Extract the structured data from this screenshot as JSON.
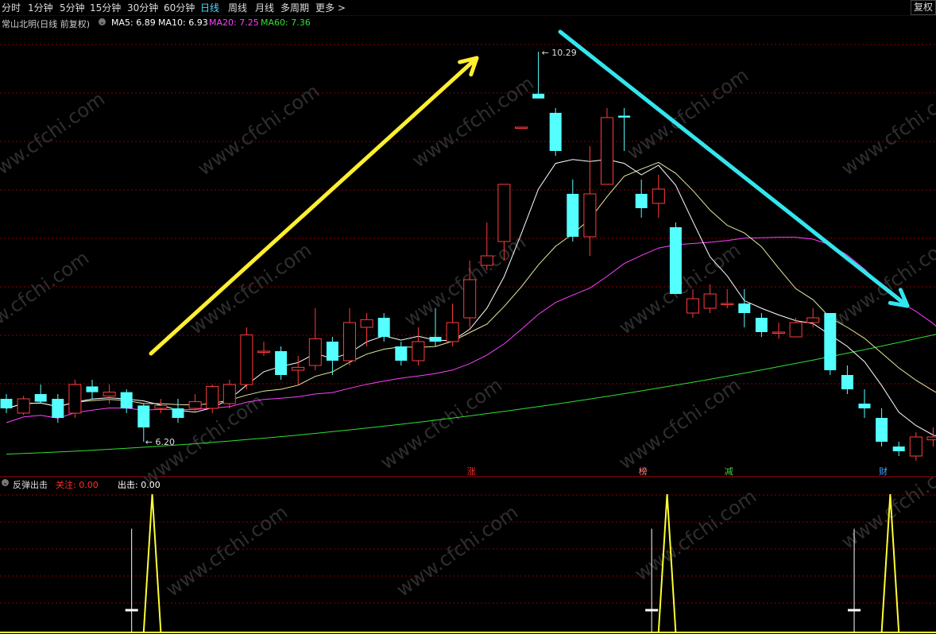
{
  "toolbar": {
    "items": [
      "分时",
      "1分钟",
      "5分钟",
      "15分钟",
      "30分钟",
      "60分钟",
      "日线",
      "周线",
      "月线",
      "多周期",
      "更多 >"
    ],
    "active_index": 6,
    "fq_button": "复权"
  },
  "main_info": {
    "title": "常山北明(日线 前复权)",
    "ma5": "MA5: 6.89",
    "ma10": "MA10: 6.93",
    "ma20": "MA20: 7.25",
    "ma60": "MA60: 7.36"
  },
  "indicator_info": {
    "name": "反弹出击",
    "focus": "关注: 0.00",
    "strike": "出击: 0.00"
  },
  "watermark": "www.cfchi.com",
  "event_markers": [
    {
      "label": "涨",
      "color": "#ff3030",
      "index": 27
    },
    {
      "label": "榜",
      "color": "#ff8080",
      "index": 37
    },
    {
      "label": "减",
      "color": "#40d040",
      "index": 42
    },
    {
      "label": "财",
      "color": "#40a0ff",
      "index": 51
    }
  ],
  "annotations": {
    "high_label": "10.29",
    "low_label": "6.20"
  },
  "colors": {
    "up": "#ff3c3c",
    "down": "#54ffff",
    "ma5": "#ffffff",
    "ma10": "#e8e8a0",
    "ma20": "#ff40ff",
    "ma60": "#30e030",
    "arrow_up": "#ffef30",
    "arrow_down": "#33e5ee",
    "grid": "#8a0000",
    "indicator_line": "#ffff30",
    "indicator_bar": "#ffffff"
  },
  "chart_data": {
    "type": "candlestick",
    "y_range": [
      6.0,
      10.5
    ],
    "candles": [
      [
        6.65,
        6.55,
        6.7,
        6.5
      ],
      [
        6.5,
        6.65,
        6.68,
        6.48
      ],
      [
        6.7,
        6.62,
        6.8,
        6.6
      ],
      [
        6.65,
        6.45,
        6.7,
        6.4
      ],
      [
        6.5,
        6.8,
        6.85,
        6.45
      ],
      [
        6.78,
        6.72,
        6.85,
        6.65
      ],
      [
        6.68,
        6.72,
        6.8,
        6.6
      ],
      [
        6.72,
        6.55,
        6.75,
        6.5
      ],
      [
        6.58,
        6.35,
        6.6,
        6.2
      ],
      [
        6.55,
        6.58,
        6.65,
        6.5
      ],
      [
        6.55,
        6.45,
        6.65,
        6.4
      ],
      [
        6.55,
        6.62,
        6.7,
        6.52
      ],
      [
        6.55,
        6.78,
        6.8,
        6.5
      ],
      [
        6.6,
        6.8,
        6.85,
        6.55
      ],
      [
        6.8,
        7.32,
        7.4,
        6.75
      ],
      [
        7.15,
        7.15,
        7.25,
        7.1
      ],
      [
        7.15,
        6.9,
        7.2,
        6.85
      ],
      [
        6.95,
        6.98,
        7.1,
        6.8
      ],
      [
        7.0,
        7.28,
        7.6,
        6.95
      ],
      [
        7.25,
        7.05,
        7.3,
        6.9
      ],
      [
        7.05,
        7.45,
        7.6,
        7.0
      ],
      [
        7.4,
        7.48,
        7.55,
        7.2
      ],
      [
        7.5,
        7.3,
        7.55,
        7.25
      ],
      [
        7.2,
        7.05,
        7.25,
        7.0
      ],
      [
        7.05,
        7.25,
        7.4,
        7.0
      ],
      [
        7.3,
        7.25,
        7.6,
        7.2
      ],
      [
        7.25,
        7.45,
        7.65,
        7.2
      ],
      [
        7.5,
        7.9,
        8.1,
        7.4
      ],
      [
        8.05,
        8.15,
        8.5,
        8.0
      ],
      [
        8.3,
        8.9,
        8.9,
        8.1
      ],
      [
        9.5,
        9.5,
        9.5,
        9.5
      ],
      [
        9.85,
        9.8,
        10.29,
        9.8
      ],
      [
        9.65,
        9.25,
        9.7,
        9.2
      ],
      [
        8.8,
        8.35,
        8.95,
        8.3
      ],
      [
        8.35,
        8.8,
        9.3,
        8.15
      ],
      [
        8.9,
        9.6,
        9.7,
        8.9
      ],
      [
        9.62,
        9.6,
        9.7,
        9.25
      ],
      [
        8.8,
        8.65,
        8.95,
        8.55
      ],
      [
        8.7,
        8.85,
        9.0,
        8.55
      ],
      [
        8.45,
        7.75,
        8.5,
        7.75
      ],
      [
        7.55,
        7.7,
        7.8,
        7.5
      ],
      [
        7.6,
        7.75,
        7.85,
        7.55
      ],
      [
        7.65,
        7.65,
        7.8,
        7.6
      ],
      [
        7.65,
        7.55,
        7.8,
        7.4
      ],
      [
        7.5,
        7.35,
        7.55,
        7.3
      ],
      [
        7.35,
        7.35,
        7.45,
        7.28
      ],
      [
        7.3,
        7.45,
        7.5,
        7.3
      ],
      [
        7.45,
        7.5,
        7.6,
        7.4
      ],
      [
        7.55,
        6.95,
        7.55,
        6.9
      ],
      [
        6.9,
        6.75,
        7.0,
        6.7
      ],
      [
        6.6,
        6.55,
        6.75,
        6.45
      ],
      [
        6.45,
        6.2,
        6.55,
        6.15
      ],
      [
        6.15,
        6.1,
        6.2,
        6.05
      ],
      [
        6.05,
        6.25,
        6.3,
        6.0
      ],
      [
        6.22,
        6.25,
        6.35,
        6.15
      ],
      [
        6.25,
        6.35,
        6.45,
        6.2
      ]
    ],
    "ma60_endpoints": [
      6.07,
      7.36
    ],
    "indicator": {
      "y_range": [
        0,
        100
      ],
      "spikes": [
        {
          "start": 8,
          "peak": 8.5,
          "end": 9,
          "value": 100
        },
        {
          "start": 38,
          "peak": 38.5,
          "end": 39,
          "value": 100
        },
        {
          "start": 51,
          "peak": 51.5,
          "end": 52,
          "value": 100
        }
      ],
      "bars": [
        {
          "index": 7.3,
          "value": 75
        },
        {
          "index": 37.6,
          "value": 75
        },
        {
          "index": 49.4,
          "value": 75
        }
      ]
    }
  }
}
